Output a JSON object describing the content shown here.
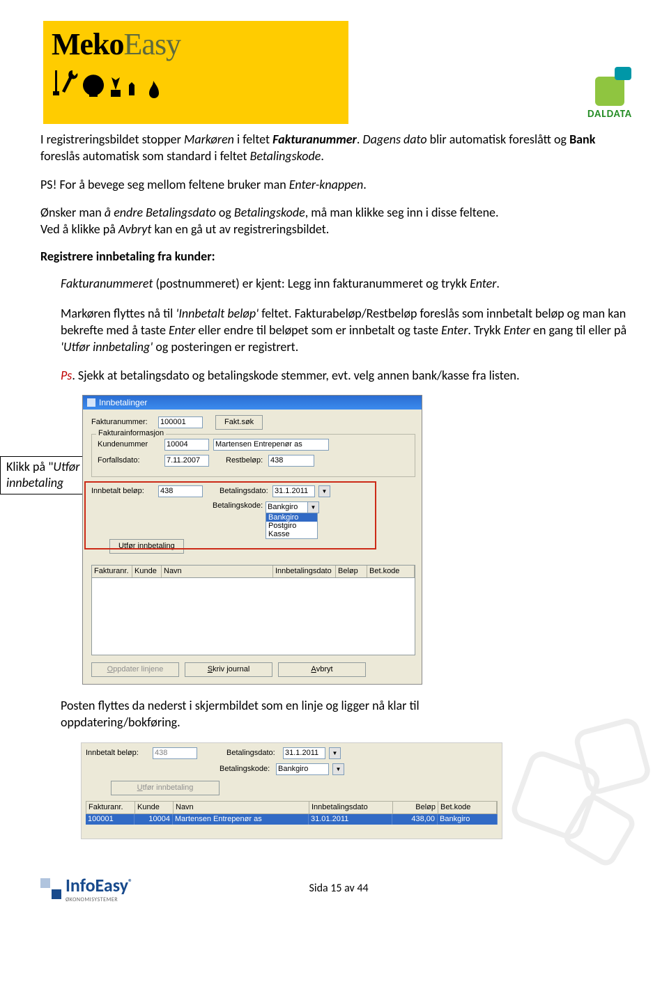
{
  "brand": {
    "meko": "Meko",
    "easy": "Easy"
  },
  "daldata": "DALDATA",
  "para1": {
    "a": "I registreringsbildet stopper ",
    "markoren": "Markøren",
    "b": " i feltet ",
    "faktnr": "Fakturanummer",
    "c": ". ",
    "dagens": "Dagens dato",
    "d": " blir automatisk foreslått og ",
    "bank": "Bank",
    "e": " foreslås automatisk som standard i feltet ",
    "betkode": "Betalingskode",
    "f": "."
  },
  "para2": {
    "a": "PS! For å bevege seg mellom feltene bruker man ",
    "enter": "Enter-knappen",
    "b": "."
  },
  "para3": {
    "a": "Ønsker man ",
    "endre": "å endre Betalingsdato",
    "b": " og ",
    "betkode": "Betalingskode",
    "c": ", må man klikke seg inn i disse feltene."
  },
  "para3b": {
    "a": "Ved å klikke på ",
    "avbryt": "Avbryt",
    "b": " kan en gå ut av registreringsbildet."
  },
  "heading": "Registrere innbetaling fra kunder:",
  "para4": {
    "faktnr": "Fakturanummeret",
    "a": " (postnummeret) er kjent:  Legg inn fakturanummeret og trykk ",
    "enter": "Enter",
    "b": "."
  },
  "para5": {
    "a": "Markøren flyttes nå til ",
    "innbel": "'Innbetalt beløp'",
    "b": " feltet. Fakturabeløp/Restbeløp foreslås som innbetalt beløp og man kan bekrefte med å taste ",
    "enter": "Enter",
    "c": " eller endre til beløpet som er innbetalt og taste ",
    "enter2": "Enter",
    "d": ".  Trykk ",
    "enter3": "Enter",
    "e": " en gang til eller på ",
    "utfor": "'Utfør innbetaling'",
    "f": " og posteringen er registrert."
  },
  "para6": {
    "ps": "Ps",
    "a": ".  Sjekk at betalingsdato og betalingskode stemmer, evt. velg annen bank/kasse fra listen."
  },
  "callout": {
    "a": "Klikk på \"",
    "utfor": "Utfør innbetaling",
    "b": ""
  },
  "dialog1": {
    "title": "Innbetalinger",
    "faktnr_lbl": "Fakturanummer:",
    "faktnr_val": "100001",
    "faktsok": "Fakt.søk",
    "faktinfo_legend": "Fakturainformasjon",
    "kundenr_lbl": "Kundenummer",
    "kundenr_val": "10004",
    "kundenavn": "Martensen Entrepenør as",
    "forfall_lbl": "Forfallsdato:",
    "forfall_val": "7.11.2007",
    "rest_lbl": "Restbeløp:",
    "rest_val": "438",
    "innbel_lbl": "Innbetalt beløp:",
    "innbel_val": "438",
    "betdato_lbl": "Betalingsdato:",
    "betdato_val": "31.1.2011",
    "betkode_lbl": "Betalingskode:",
    "betkode_val": "Bankgiro",
    "drop_opts": [
      "Bankgiro",
      "Postgiro",
      "Kasse"
    ],
    "utfor_btn": "Utfør innbetaling",
    "gridh": [
      "Fakturanr.",
      "Kunde",
      "Navn",
      "Innbetalingsdato",
      "Beløp",
      "Bet.kode"
    ],
    "oppdater": "Oppdater linjene",
    "skriv": "Skriv journal",
    "avbryt": "Avbryt"
  },
  "para7": "Posten flyttes da nederst i skjermbildet som en linje og ligger nå klar til oppdatering/bokføring.",
  "dialog2": {
    "innbel_lbl": "Innbetalt beløp:",
    "innbel_val": "438",
    "betdato_lbl": "Betalingsdato:",
    "betdato_val": "31.1.2011",
    "betkode_lbl": "Betalingskode:",
    "betkode_val": "Bankgiro",
    "utfor_btn": "Utfør innbetaling",
    "gridh": [
      "Fakturanr.",
      "Kunde",
      "Navn",
      "Innbetalingsdato",
      "Beløp",
      "Bet.kode"
    ],
    "row": [
      "100001",
      "10004",
      "Martensen Entrepenør as",
      "31.01.2011",
      "438,00",
      "Bankgiro"
    ]
  },
  "footer": {
    "info": "InfoEasy",
    "sub": "ØKONOMISYSTEMER",
    "page": "Sida 15 av 44"
  }
}
